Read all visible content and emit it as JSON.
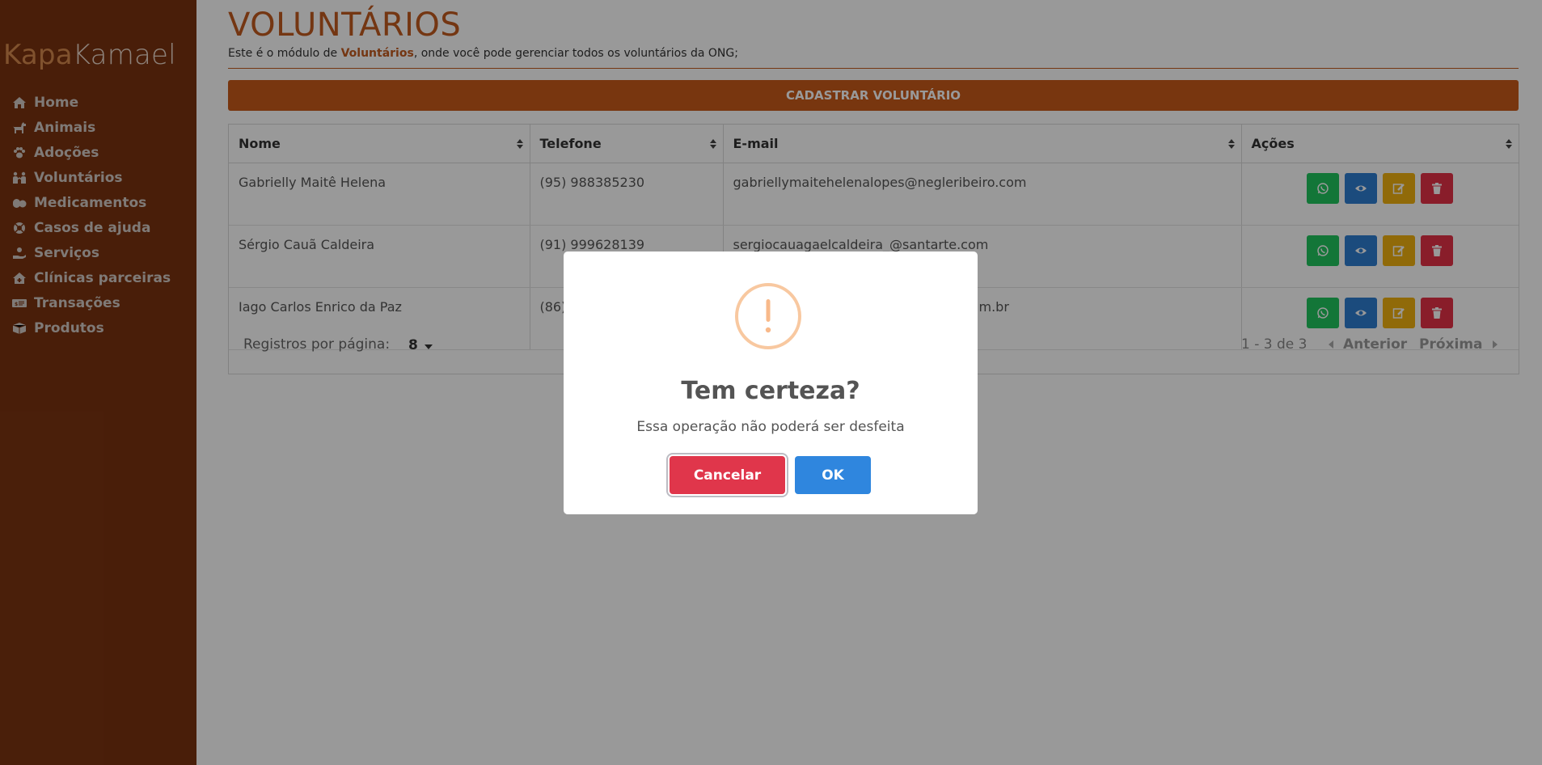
{
  "brand": {
    "part1": "Kapa",
    "part2": "Kamael"
  },
  "sidebar": {
    "items": [
      {
        "label": "Home",
        "icon": "home-icon"
      },
      {
        "label": "Animais",
        "icon": "dog-icon"
      },
      {
        "label": "Adoções",
        "icon": "paw-icon"
      },
      {
        "label": "Voluntários",
        "icon": "people-icon"
      },
      {
        "label": "Medicamentos",
        "icon": "pills-icon"
      },
      {
        "label": "Casos de ajuda",
        "icon": "lifebuoy-icon"
      },
      {
        "label": "Serviços",
        "icon": "hand-service-icon"
      },
      {
        "label": "Clínicas parceiras",
        "icon": "clinic-icon"
      },
      {
        "label": "Transações",
        "icon": "money-bill-icon"
      },
      {
        "label": "Produtos",
        "icon": "box-icon"
      }
    ]
  },
  "page": {
    "title": "VOLUNTÁRIOS",
    "subtitle_prefix": "Este é o módulo de ",
    "subtitle_bold": "Voluntários",
    "subtitle_suffix": ", onde você pode gerenciar todos os voluntários da ONG;",
    "create_button": "CADASTRAR VOLUNTÁRIO"
  },
  "table": {
    "columns": [
      "Nome",
      "Telefone",
      "E-mail",
      "Ações"
    ],
    "rows": [
      {
        "nome": "Gabrielly Maitê Helena",
        "telefone": "(95) 988385230",
        "email": "gabriellymaitehelenalopes@negleribeiro.com"
      },
      {
        "nome": "Sérgio Cauã Caldeira",
        "telefone": "(91) 999628139",
        "email": "sergiocauagaelcaldeira_@santarte.com"
      },
      {
        "nome": "Iago Carlos Enrico da Paz",
        "telefone": "(86)",
        "email": "m.br"
      }
    ],
    "footer": {
      "rows_per_page_label": "Registros por página:",
      "rows_per_page_value": "8",
      "range": "1 - 3 de 3",
      "prev": "Anterior",
      "next": "Próxima"
    }
  },
  "dialog": {
    "icon": "exclamation-icon",
    "title": "Tem certeza?",
    "text": "Essa operação não poderá ser desfeita",
    "cancel": "Cancelar",
    "ok": "OK"
  },
  "colors": {
    "sidebar": "#7b3310",
    "accent": "#c95a1a",
    "whatsapp": "#21c55e",
    "view": "#2e7dd0",
    "edit": "#f1b10f",
    "delete": "#e53146"
  }
}
